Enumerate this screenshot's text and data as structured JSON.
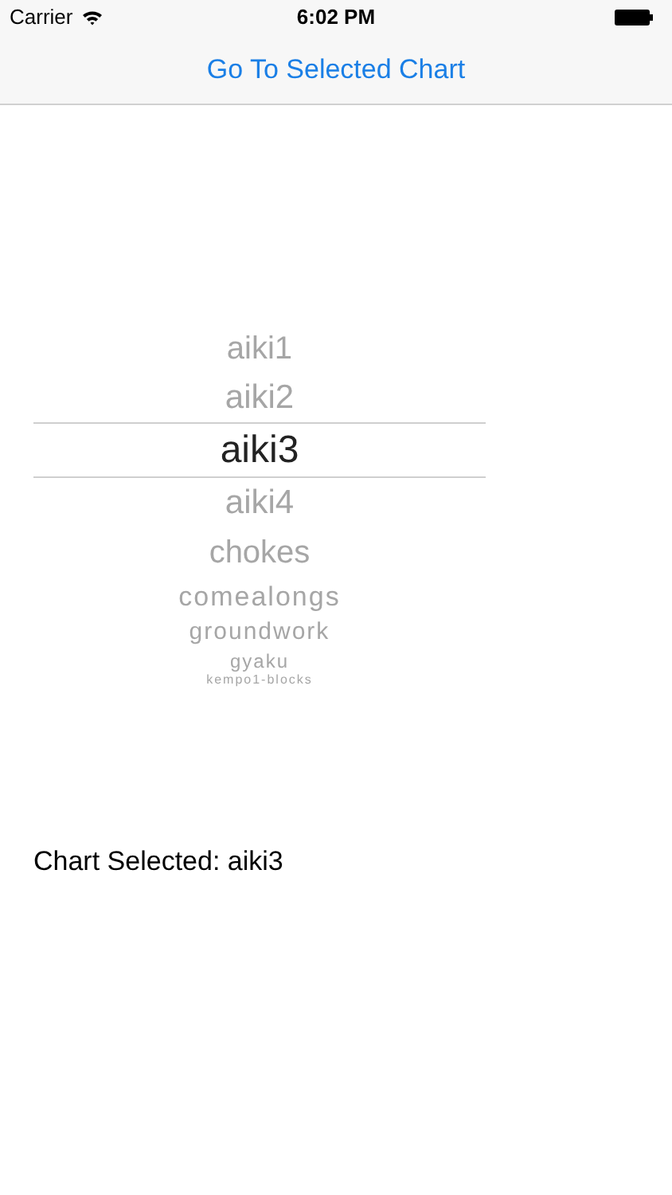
{
  "status_bar": {
    "carrier": "Carrier",
    "time": "6:02 PM"
  },
  "nav_bar": {
    "button": "Go To Selected Chart"
  },
  "picker": {
    "items": [
      {
        "label": "aiki1",
        "selected": false
      },
      {
        "label": "aiki2",
        "selected": false
      },
      {
        "label": "aiki3",
        "selected": true
      },
      {
        "label": "aiki4",
        "selected": false
      },
      {
        "label": "chokes",
        "selected": false
      },
      {
        "label": "comealongs",
        "selected": false
      },
      {
        "label": "groundwork",
        "selected": false
      },
      {
        "label": "gyaku",
        "selected": false
      },
      {
        "label": "kempo1-blocks",
        "selected": false
      }
    ]
  },
  "result": "Chart Selected: aiki3"
}
